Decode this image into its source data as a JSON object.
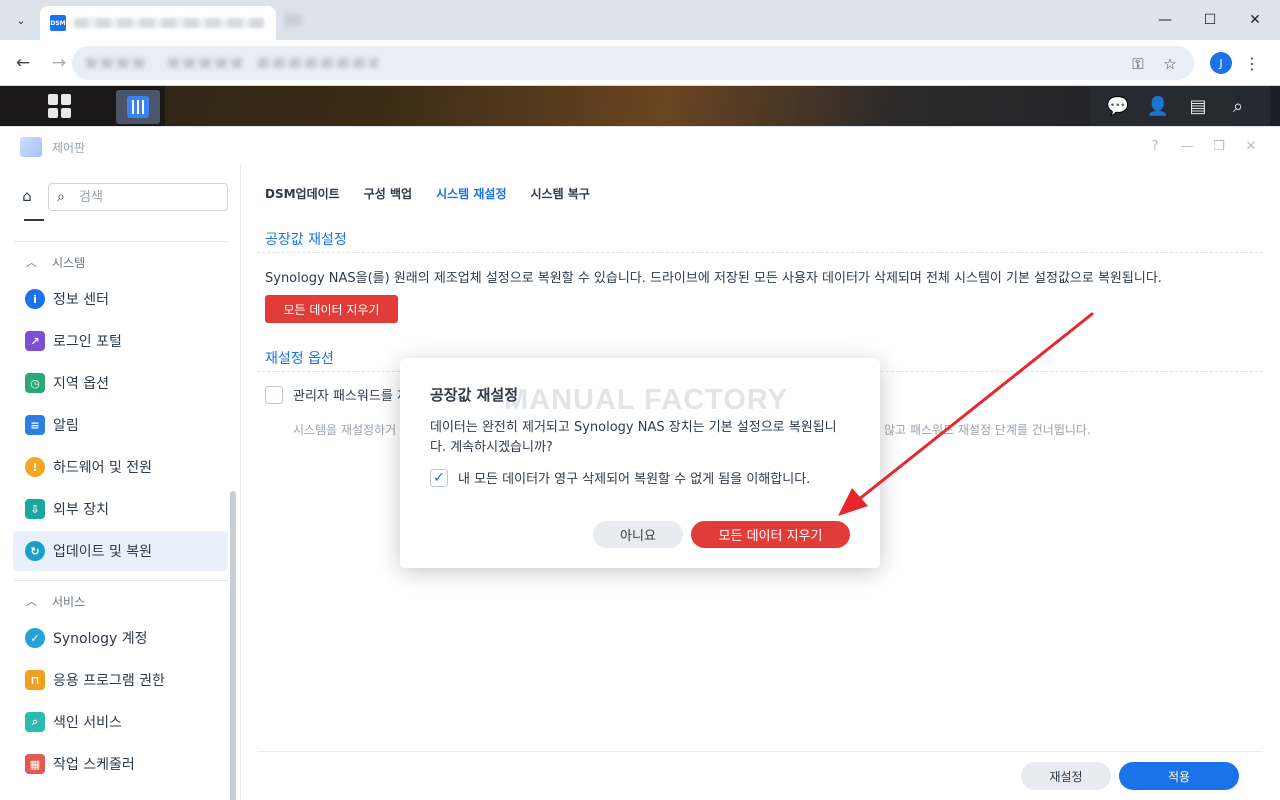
{
  "browser": {
    "favicon_text": "DSM",
    "profile_initial": "J"
  },
  "window": {
    "title": "제어판"
  },
  "sidebar": {
    "search_placeholder": "검색",
    "sections": [
      {
        "title": "시스템",
        "items": [
          {
            "label": "정보 센터",
            "icon": "info-icon",
            "color": "#1a73e8"
          },
          {
            "label": "로그인 포털",
            "icon": "login-portal-icon",
            "color": "#7b4fd6"
          },
          {
            "label": "지역 옵션",
            "icon": "region-icon",
            "color": "#2aa876"
          },
          {
            "label": "알림",
            "icon": "notification-icon",
            "color": "#2f7de1"
          },
          {
            "label": "하드웨어 및 전원",
            "icon": "bulb-icon",
            "color": "#f5a623"
          },
          {
            "label": "외부 장치",
            "icon": "external-device-icon",
            "color": "#1aa7a0"
          },
          {
            "label": "업데이트 및 복원",
            "icon": "update-restore-icon",
            "color": "#1a9fc9",
            "active": true
          }
        ]
      },
      {
        "title": "서비스",
        "items": [
          {
            "label": "Synology 계정",
            "icon": "account-icon",
            "color": "#25a3d8"
          },
          {
            "label": "응용 프로그램 권한",
            "icon": "lock-icon",
            "color": "#f0a020"
          },
          {
            "label": "색인 서비스",
            "icon": "index-icon",
            "color": "#2bbbb0"
          },
          {
            "label": "작업 스케줄러",
            "icon": "calendar-icon",
            "color": "#e25a4f"
          }
        ]
      }
    ]
  },
  "tabs": [
    {
      "label": "DSM업데이트",
      "active": false
    },
    {
      "label": "구성 백업",
      "active": false
    },
    {
      "label": "시스템 재설정",
      "active": true
    },
    {
      "label": "시스템 복구",
      "active": false
    }
  ],
  "factory_reset": {
    "title": "공장값 재설정",
    "description": "Synology NAS을(를) 원래의 제조업체 설정으로 복원할 수 있습니다. 드라이브에 저장된 모든 사용자 데이터가 삭제되며 전체 시스템이 기본 설정값으로 복원됩니다.",
    "button": "모든 데이터 지우기"
  },
  "reset_options": {
    "title": "재설정 옵션",
    "checkbox_label": "관리자 패스워드를 재설정",
    "helper_left": "시스템을 재설정하거",
    "helper_right": "않고 패스워드 재설정 단계를 건너뜁니다."
  },
  "footer": {
    "reset": "재설정",
    "apply": "적용"
  },
  "modal": {
    "title": "공장값 재설정",
    "watermark": "MANUAL FACTORY",
    "message": "데이터는 완전히 제거되고 Synology NAS 장치는 기본 설정으로 복원됩니다. 계속하시겠습니까?",
    "checkbox_label": "내 모든 데이터가 영구 삭제되어 복원할 수 없게 됨을 이해합니다.",
    "checkbox_checked": true,
    "cancel": "아니요",
    "confirm": "모든 데이터 지우기"
  },
  "annotation": {
    "arrow_color": "#e8262b"
  }
}
